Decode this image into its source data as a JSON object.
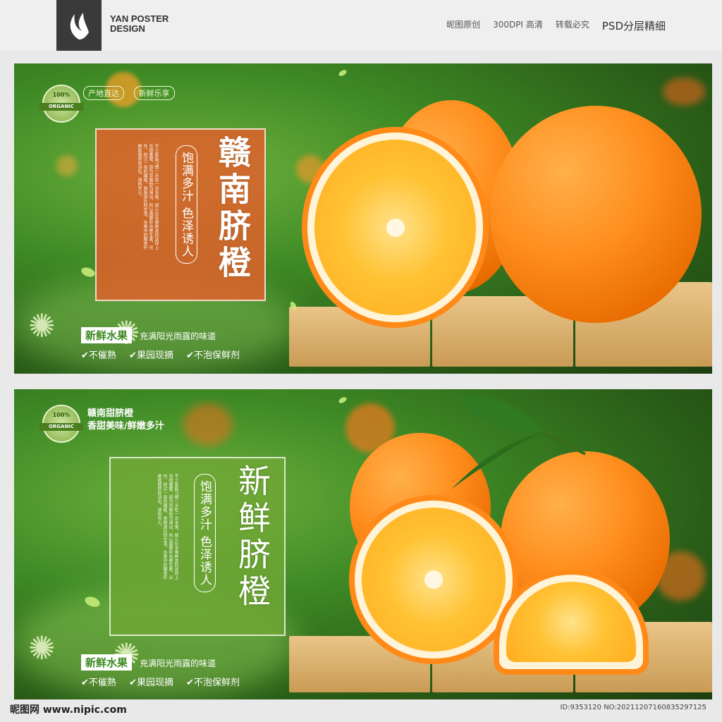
{
  "header": {
    "brand_line1": "YAN POSTER",
    "brand_line2": "DESIGN",
    "links": [
      "昵图原创",
      "300DPI 高清",
      "转载必究"
    ],
    "psd_label": "PSD分层精细"
  },
  "banner1": {
    "badge_pct": "100%",
    "badge_label": "ORGANIC",
    "top_tags": [
      "产地直达",
      "新鲜乐享"
    ],
    "tagline": "饱满多汁 色泽诱人",
    "title": "赣南脐橙",
    "para": "不少家庭习惯一天吃一次水果，那么在水果种类的选择上也很重要，因为早餐较为清淡，所以需要补充维生素，另外，经过一夜的睡眠，胃肠道比较空荡，水果中的膳食纤维能够帮助消化，清热去火。",
    "fresh_tag": "新鲜水果",
    "fresh_sub": "充满阳光雨露的味道",
    "checks": [
      "✔不催熟",
      "✔果园现摘",
      "✔不泡保鲜剂"
    ]
  },
  "banner2": {
    "badge_pct": "100%",
    "badge_label": "ORGANIC",
    "slogan_line1": "赣南甜脐橙",
    "slogan_line2": "香甜美味/鲜嫩多汁",
    "tagline": "饱满多汁 色泽诱人",
    "title": "新鲜脐橙",
    "para": "不少家庭习惯一天吃一次水果，那么在水果种类的选择上也很重要，因为早餐较为清淡，所以需要补充维生素，另外，经过一夜的睡眠，胃肠道比较空荡，水果中的膳食纤维能够帮助消化，清热去火。",
    "fresh_tag": "新鲜水果",
    "fresh_sub": "充满阳光雨露的味道",
    "checks": [
      "✔不催熟",
      "✔果园现摘",
      "✔不泡保鲜剂"
    ]
  },
  "footer": {
    "site": "昵图网 www.nipic.com",
    "id": "ID:9353120 NO:20211207160835297125"
  },
  "colors": {
    "panel1": "#e0602a",
    "panel2": "#6fa635",
    "orange": "#ff8f1f"
  }
}
